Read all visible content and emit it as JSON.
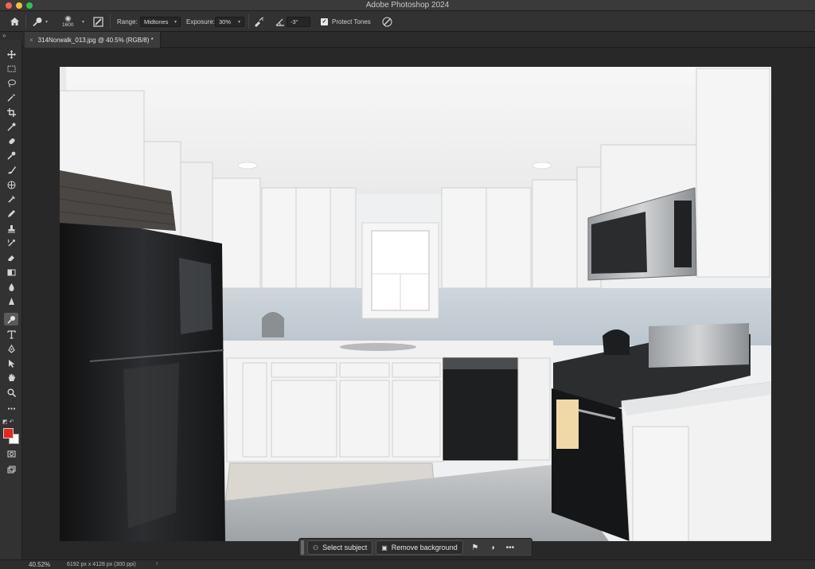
{
  "window": {
    "title": "Adobe Photoshop 2024"
  },
  "options_bar": {
    "brush_size": "1600",
    "range_label": "Range:",
    "range_value": "Midtones",
    "exposure_label": "Exposure:",
    "exposure_value": "30%",
    "angle_value": "-3°",
    "protect_tones_label": "Protect Tones",
    "protect_tones_checked": true
  },
  "document": {
    "tab_label": "314Norwalk_013.jpg @ 40.5% (RGB/8) *",
    "close_glyph": "×"
  },
  "toolbar": {
    "tools": [
      {
        "name": "move-tool-icon"
      },
      {
        "name": "marquee-tool-icon"
      },
      {
        "name": "lasso-tool-icon"
      },
      {
        "name": "magic-wand-tool-icon"
      },
      {
        "name": "crop-tool-icon"
      },
      {
        "name": "eyedropper-tool-icon"
      },
      {
        "name": "spot-healing-tool-icon"
      },
      {
        "name": "healing-brush-tool-icon"
      },
      {
        "name": "brush-tool-icon"
      },
      {
        "name": "clone-stamp-tool-icon"
      },
      {
        "name": "history-brush-tool-icon"
      },
      {
        "name": "pencil-tool-icon"
      },
      {
        "name": "stamp-tool-icon"
      },
      {
        "name": "art-history-tool-icon"
      },
      {
        "name": "eraser-tool-icon"
      },
      {
        "name": "gradient-tool-icon"
      },
      {
        "name": "blur-tool-icon"
      },
      {
        "name": "sharpen-tool-icon"
      },
      {
        "name": "dodge-tool-icon",
        "active": true
      },
      {
        "name": "type-tool-icon"
      },
      {
        "name": "pen-tool-icon"
      },
      {
        "name": "path-selection-tool-icon"
      },
      {
        "name": "hand-tool-icon"
      },
      {
        "name": "zoom-tool-icon"
      },
      {
        "name": "more-tools-icon"
      }
    ],
    "foreground_color": "#e8251c",
    "background_color": "#ffffff"
  },
  "taskbar": {
    "select_subject_label": "Select subject",
    "remove_background_label": "Remove background"
  },
  "status": {
    "zoom": "40.52%",
    "dimensions": "6192 px x 4128 px (300 ppi)",
    "arrow": "›"
  }
}
